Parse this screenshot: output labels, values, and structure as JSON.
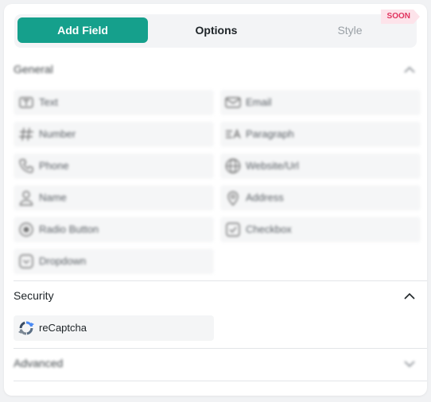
{
  "tabs": {
    "add_field": "Add Field",
    "options": "Options",
    "style": "Style",
    "soon_badge": "SOON"
  },
  "sections": {
    "general": {
      "title": "General",
      "expanded": true,
      "fields": [
        {
          "label": "Text",
          "icon": "text-icon"
        },
        {
          "label": "Email",
          "icon": "email-icon"
        },
        {
          "label": "Number",
          "icon": "hash-icon"
        },
        {
          "label": "Paragraph",
          "icon": "paragraph-icon"
        },
        {
          "label": "Phone",
          "icon": "phone-icon"
        },
        {
          "label": "Website/Url",
          "icon": "globe-icon"
        },
        {
          "label": "Name",
          "icon": "person-icon"
        },
        {
          "label": "Address",
          "icon": "location-pin-icon"
        },
        {
          "label": "Radio Button",
          "icon": "radio-icon"
        },
        {
          "label": "Checkbox",
          "icon": "checkbox-icon"
        },
        {
          "label": "Dropdown",
          "icon": "dropdown-icon"
        }
      ]
    },
    "security": {
      "title": "Security",
      "expanded": true,
      "fields": [
        {
          "label": "reCaptcha",
          "icon": "recaptcha-icon"
        }
      ]
    },
    "advanced": {
      "title": "Advanced",
      "expanded": false
    }
  },
  "colors": {
    "accent": "#15a08c",
    "soon_bg": "#fde3ea",
    "soon_text": "#e0335e"
  }
}
